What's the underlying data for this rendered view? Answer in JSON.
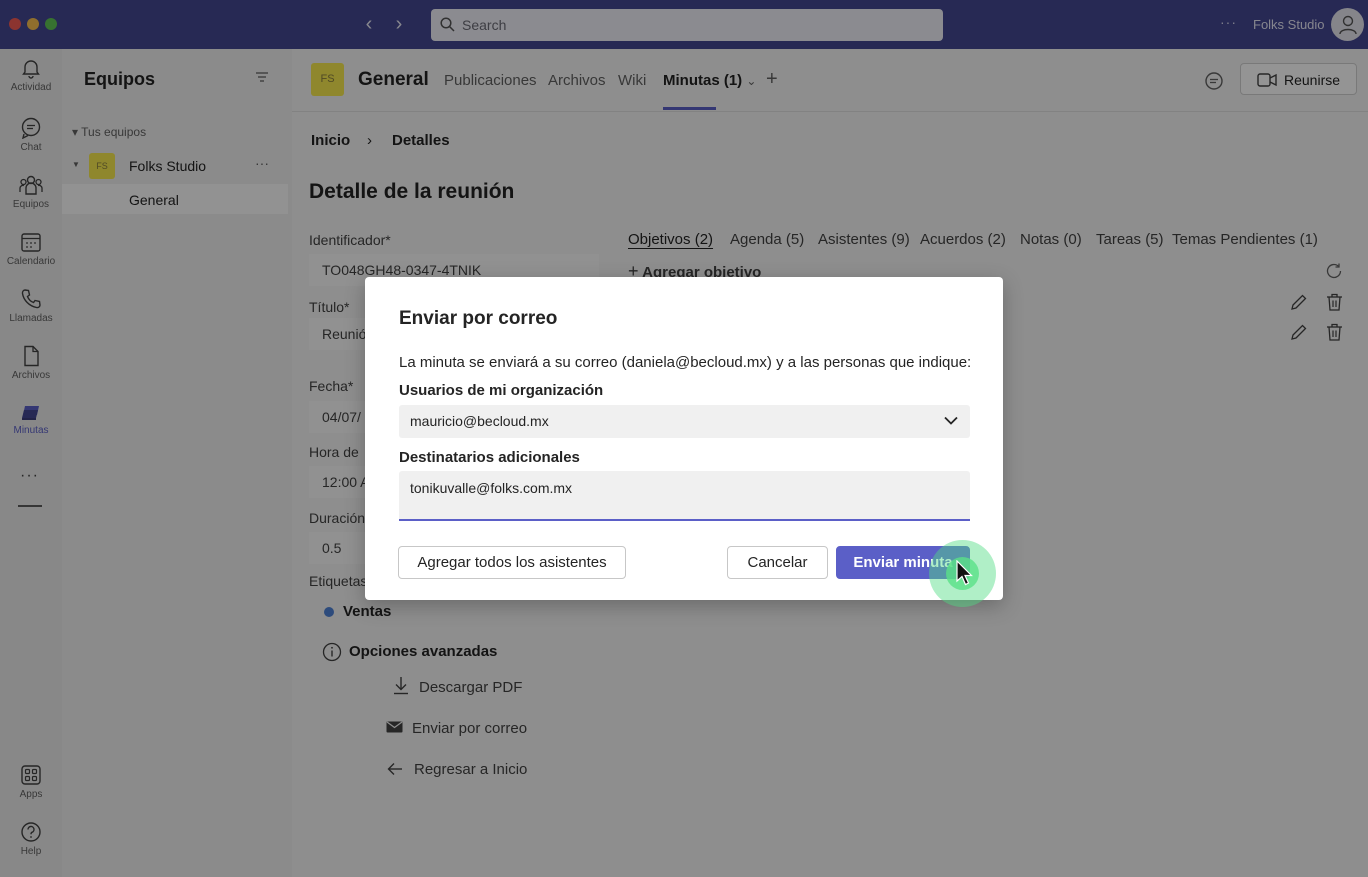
{
  "titlebar": {
    "search_placeholder": "Search",
    "more": "···",
    "org_name": "Folks Studio"
  },
  "rail": {
    "items": [
      {
        "label": "Actividad",
        "icon": "bell-icon"
      },
      {
        "label": "Chat",
        "icon": "chat-icon"
      },
      {
        "label": "Equipos",
        "icon": "teams-icon"
      },
      {
        "label": "Calendario",
        "icon": "calendar-icon"
      },
      {
        "label": "Llamadas",
        "icon": "phone-icon"
      },
      {
        "label": "Archivos",
        "icon": "file-icon"
      },
      {
        "label": "Minutas",
        "icon": "minutas-icon",
        "active": true
      }
    ],
    "more": "···",
    "bottom": [
      {
        "label": "Apps",
        "icon": "apps-icon"
      },
      {
        "label": "Help",
        "icon": "help-icon"
      }
    ]
  },
  "team_pane": {
    "title": "Equipos",
    "section": "Tus equipos",
    "team": {
      "initials": "FS",
      "name": "Folks Studio",
      "more": "···"
    },
    "channel": "General"
  },
  "channel_header": {
    "initials": "FS",
    "name": "General",
    "tabs": [
      "Publicaciones",
      "Archivos",
      "Wiki",
      "Minutas (1)"
    ],
    "add": "+",
    "meet_label": "Reunirse"
  },
  "main": {
    "breadcrumb": [
      "Inicio",
      "Detalles"
    ],
    "page_title": "Detalle de la reunión",
    "fields": [
      {
        "label": "Identificador*",
        "value": "TO048GH48-0347-4TNIK"
      },
      {
        "label": "Título*",
        "value": "Reunió"
      },
      {
        "label": "Fecha*",
        "value": "04/07/"
      },
      {
        "label": "Hora de",
        "value": "12:00 A"
      },
      {
        "label": "Duración",
        "value": "0.5"
      },
      {
        "label": "Etiquetas",
        "value": ""
      }
    ],
    "tag": "Ventas",
    "advanced_label": "Opciones avanzadas",
    "actions": [
      "Descargar PDF",
      "Enviar por correo",
      "Regresar a Inicio"
    ],
    "minute_tabs": [
      "Objetivos (2)",
      "Agenda (5)",
      "Asistentes (9)",
      "Acuerdos (2)",
      "Notas (0)",
      "Tareas (5)",
      "Temas Pendientes (1)"
    ],
    "add_objective": "Agregar objetivo"
  },
  "dialog": {
    "title": "Enviar por correo",
    "description": "La minuta se enviará a su correo (daniela@becloud.mx) y a las personas que indique:",
    "org_users_label": "Usuarios de mi organización",
    "org_users_value": "mauricio@becloud.mx",
    "extra_label": "Destinatarios adicionales",
    "extra_value": "tonikuvalle@folks.com.mx",
    "add_all_button": "Agregar todos los asistentes",
    "cancel_button": "Cancelar",
    "send_button": "Enviar minuta"
  },
  "colors": {
    "titlebar": "#444791",
    "accent": "#5b5fc7",
    "team_avatar": "#f6e84e",
    "click_highlight": "#50dc82"
  }
}
